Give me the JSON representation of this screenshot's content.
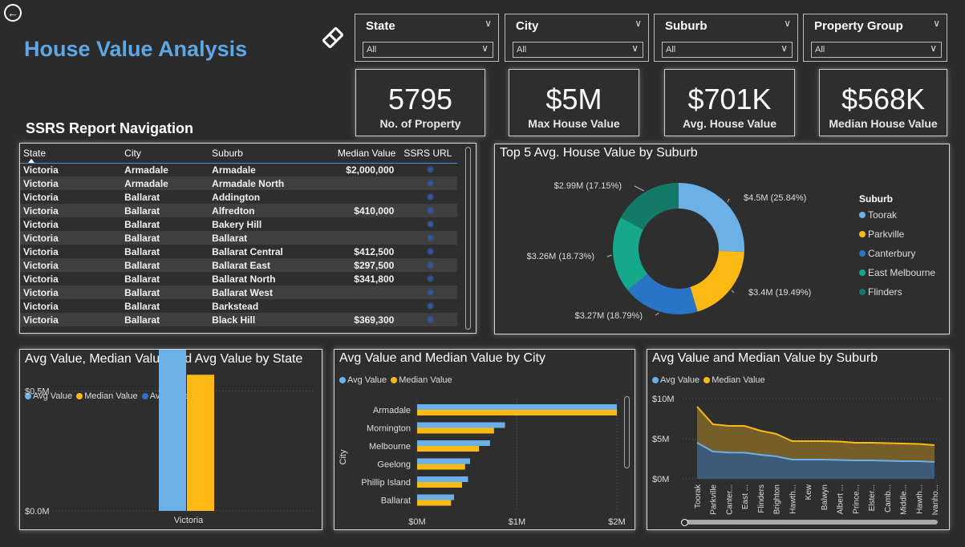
{
  "header": {
    "title": "House Value Analysis",
    "back_icon": "back-arrow-icon",
    "eraser_icon": "eraser-icon"
  },
  "slicers": [
    {
      "title": "State",
      "value": "All"
    },
    {
      "title": "City",
      "value": "All"
    },
    {
      "title": "Suburb",
      "value": "All"
    },
    {
      "title": "Property Group",
      "value": "All"
    }
  ],
  "cards": [
    {
      "value": "5795",
      "label": "No. of Property"
    },
    {
      "value": "$5M",
      "label": "Max House Value"
    },
    {
      "value": "$701K",
      "label": "Avg. House Value"
    },
    {
      "value": "$568K",
      "label": "Median House Value"
    }
  ],
  "report_nav": {
    "title": "SSRS Report Navigation",
    "columns": [
      "State",
      "City",
      "Suburb",
      "Median Value",
      "SSRS URL"
    ],
    "rows": [
      [
        "Victoria",
        "Armadale",
        "Armadale",
        "$2,000,000"
      ],
      [
        "Victoria",
        "Armadale",
        "Armadale North",
        ""
      ],
      [
        "Victoria",
        "Ballarat",
        "Addington",
        ""
      ],
      [
        "Victoria",
        "Ballarat",
        "Alfredton",
        "$410,000"
      ],
      [
        "Victoria",
        "Ballarat",
        "Bakery Hill",
        ""
      ],
      [
        "Victoria",
        "Ballarat",
        "Ballarat",
        ""
      ],
      [
        "Victoria",
        "Ballarat",
        "Ballarat Central",
        "$412,500"
      ],
      [
        "Victoria",
        "Ballarat",
        "Ballarat East",
        "$297,500"
      ],
      [
        "Victoria",
        "Ballarat",
        "Ballarat North",
        "$341,800"
      ],
      [
        "Victoria",
        "Ballarat",
        "Ballarat West",
        ""
      ],
      [
        "Victoria",
        "Ballarat",
        "Barkstead",
        ""
      ],
      [
        "Victoria",
        "Ballarat",
        "Black Hill",
        "$369,300"
      ]
    ]
  },
  "colors": {
    "avg": "#6cb0e8",
    "median": "#fdb913",
    "avg2": "#2a74c7",
    "title_blue": "#5ea6e4",
    "toorak": "#6cb0e8",
    "parkville": "#fdb913",
    "canterbury": "#2a74c7",
    "east_melbourne": "#15a88a",
    "flinders": "#137a68"
  },
  "chart_data": [
    {
      "type": "pie",
      "title": "Top 5 Avg. House Value by Suburb",
      "legend_title": "Suburb",
      "legend_position": "right",
      "slices": [
        {
          "name": "Toorak",
          "value": 4.5,
          "label": "$4.5M (25.84%)"
        },
        {
          "name": "Parkville",
          "value": 3.4,
          "label": "$3.4M (19.49%)"
        },
        {
          "name": "Canterbury",
          "value": 3.27,
          "label": "$3.27M (18.79%)"
        },
        {
          "name": "East Melbourne",
          "value": 3.26,
          "label": "$3.26M (18.73%)"
        },
        {
          "name": "Flinders",
          "value": 2.99,
          "label": "$2.99M (17.15%)"
        }
      ]
    },
    {
      "type": "bar",
      "title": "Avg Value, Median Value and Avg Value by State",
      "legend": [
        "Avg Value",
        "Median Value",
        "Avg Value"
      ],
      "categories": [
        "Victoria"
      ],
      "series": [
        {
          "name": "Avg Value",
          "values": [
            0.701
          ]
        },
        {
          "name": "Median Value",
          "values": [
            0.568
          ]
        },
        {
          "name": "Avg Value",
          "values": [
            0.701
          ]
        }
      ],
      "yticks": [
        "$0.0M",
        "$0.5M"
      ],
      "ylim": [
        0,
        1.0
      ]
    },
    {
      "type": "bar",
      "title": "Avg Value and Median Value by City",
      "ylabel": "City",
      "legend": [
        "Avg Value",
        "Median Value"
      ],
      "categories": [
        "Armadale",
        "Mornington",
        "Melbourne",
        "Geelong",
        "Phillip Island",
        "Ballarat"
      ],
      "series": [
        {
          "name": "Avg Value",
          "values": [
            2.0,
            0.88,
            0.73,
            0.53,
            0.51,
            0.37
          ]
        },
        {
          "name": "Median Value",
          "values": [
            2.0,
            0.77,
            0.62,
            0.48,
            0.45,
            0.34
          ]
        }
      ],
      "xticks": [
        "$0M",
        "$1M",
        "$2M"
      ],
      "xlim": [
        0,
        2
      ]
    },
    {
      "type": "area",
      "title": "Avg Value and Median Value by Suburb",
      "legend": [
        "Avg Value",
        "Median Value"
      ],
      "categories": [
        "Toorak",
        "Parkville",
        "Canter...",
        "East ...",
        "Flinders",
        "Brighton",
        "Hawth...",
        "Kew",
        "Balwyn",
        "Albert ...",
        "Prince...",
        "Elster...",
        "Camb...",
        "Middle...",
        "Hawth...",
        "Ivanho..."
      ],
      "series": [
        {
          "name": "Avg Value",
          "values": [
            4.5,
            3.4,
            3.27,
            3.26,
            3.0,
            2.8,
            2.4,
            2.4,
            2.4,
            2.35,
            2.3,
            2.3,
            2.25,
            2.2,
            2.2,
            2.1
          ]
        },
        {
          "name": "Median Value",
          "values": [
            9.0,
            6.8,
            6.6,
            6.6,
            6.0,
            5.6,
            4.7,
            4.7,
            4.7,
            4.65,
            4.5,
            4.5,
            4.45,
            4.4,
            4.35,
            4.2
          ]
        }
      ],
      "yticks": [
        "$0M",
        "$5M",
        "$10M"
      ],
      "ylim": [
        0,
        10
      ]
    }
  ]
}
